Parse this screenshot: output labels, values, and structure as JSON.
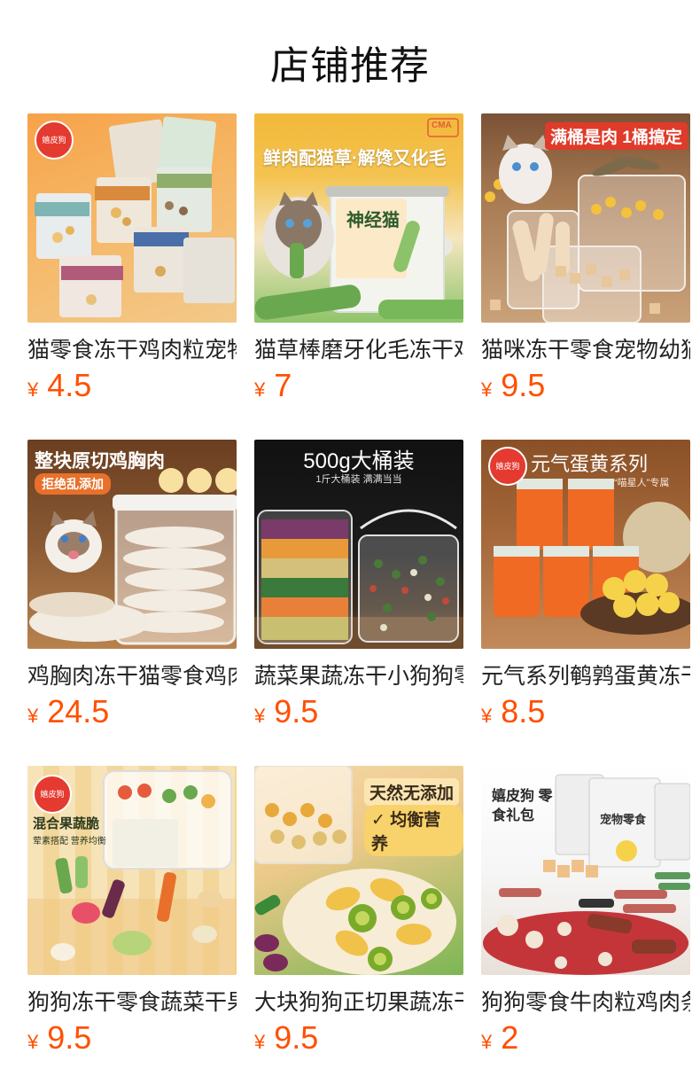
{
  "page_title": "店铺推荐",
  "currency": "¥",
  "products": [
    {
      "name": "猫零食冻干鸡肉粒宠物",
      "price": "4.5",
      "image": {
        "banner": "",
        "sub": "",
        "logo": "嬉皮狗",
        "theme": "freeze-dried-packs"
      }
    },
    {
      "name": "猫草棒磨牙化毛冻干鸡",
      "price": "7",
      "image": {
        "banner": "鲜肉配猫草·解馋又化毛",
        "sub": "神经猫",
        "logo": "CMA",
        "theme": "catgrass-sticks"
      }
    },
    {
      "name": "猫咪冻干零食宠物幼猫",
      "price": "9.5",
      "image": {
        "banner": "满桶是肉 1桶搞定",
        "sub": "",
        "logo": "",
        "theme": "bucket-meat"
      }
    },
    {
      "name": "鸡胸肉冻干猫零食鸡肉",
      "price": "24.5",
      "image": {
        "banner": "整块原切鸡胸肉",
        "sub": "拒绝乱添加",
        "logo": "",
        "theme": "chicken-breast"
      }
    },
    {
      "name": "蔬菜果蔬冻干小狗狗零",
      "price": "9.5",
      "image": {
        "banner": "500g大桶装",
        "sub": "1斤大桶装 满满当当",
        "logo": "",
        "theme": "veggie-jars"
      }
    },
    {
      "name": "元气系列鹌鹑蛋黄冻干",
      "price": "8.5",
      "image": {
        "banner": "元气蛋黄系列",
        "sub": "“喵星人”专属",
        "logo": "嬉皮狗",
        "theme": "egg-yolk"
      }
    },
    {
      "name": "狗狗冻干零食蔬菜干果",
      "price": "9.5",
      "image": {
        "banner": "混合果蔬脆",
        "sub": "荤素搭配 营养均衡",
        "logo": "嬉皮狗",
        "theme": "mixed-veg"
      }
    },
    {
      "name": "大块狗狗正切果蔬冻干",
      "price": "9.5",
      "image": {
        "banner": "天然无添加",
        "sub": "均衡营养",
        "logo": "",
        "theme": "fruit-chips"
      }
    },
    {
      "name": "狗狗零食牛肉粒鸡肉条",
      "price": "2",
      "image": {
        "banner": "嬉皮狗 零食礼包",
        "sub": "宠物零食",
        "logo": "",
        "theme": "gift-pack"
      }
    }
  ]
}
